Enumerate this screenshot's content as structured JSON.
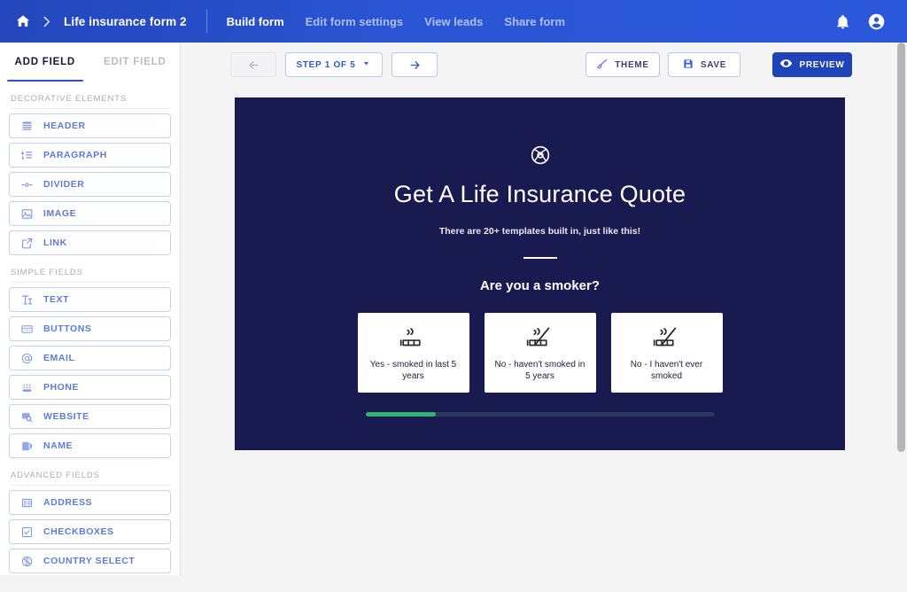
{
  "topbar": {
    "home_icon": "home-icon",
    "chevron_icon": "chevron-right-icon",
    "form_title": "Life insurance form 2",
    "nav": [
      {
        "label": "Build form",
        "active": true
      },
      {
        "label": "Edit form settings",
        "active": false
      },
      {
        "label": "View leads",
        "active": false
      },
      {
        "label": "Share form",
        "active": false
      }
    ],
    "notifications_icon": "bell-icon",
    "account_icon": "account-circle-icon",
    "accent_color": "#2a55d4"
  },
  "sidebar": {
    "tabs": [
      {
        "label": "ADD FIELD",
        "active": true
      },
      {
        "label": "EDIT FIELD",
        "active": false
      }
    ],
    "sections": [
      {
        "label": "DECORATIVE ELEMENTS",
        "items": [
          {
            "label": "HEADER",
            "icon": "header-lines-icon"
          },
          {
            "label": "PARAGRAPH",
            "icon": "paragraph-icon"
          },
          {
            "label": "DIVIDER",
            "icon": "divider-icon"
          },
          {
            "label": "IMAGE",
            "icon": "image-icon"
          },
          {
            "label": "LINK",
            "icon": "external-link-icon"
          }
        ]
      },
      {
        "label": "SIMPLE FIELDS",
        "items": [
          {
            "label": "TEXT",
            "icon": "text-cursor-icon"
          },
          {
            "label": "BUTTONS",
            "icon": "buttons-icon"
          },
          {
            "label": "EMAIL",
            "icon": "at-sign-icon"
          },
          {
            "label": "PHONE",
            "icon": "phone-keypad-icon"
          },
          {
            "label": "WEBSITE",
            "icon": "website-search-icon"
          },
          {
            "label": "NAME",
            "icon": "name-badge-icon"
          }
        ]
      },
      {
        "label": "ADVANCED FIELDS",
        "items": [
          {
            "label": "ADDRESS",
            "icon": "address-columns-icon"
          },
          {
            "label": "CHECKBOXES",
            "icon": "checkbox-icon"
          },
          {
            "label": "COUNTRY SELECT",
            "icon": "globe-icon"
          }
        ]
      }
    ]
  },
  "toolbar": {
    "back_icon": "arrow-left-icon",
    "forward_icon": "arrow-right-icon",
    "step_label": "STEP 1 OF 5",
    "step_caret_icon": "caret-down-icon",
    "theme_label": "THEME",
    "theme_icon": "paint-brush-icon",
    "save_label": "SAVE",
    "save_icon": "floppy-disk-icon",
    "preview_label": "PREVIEW",
    "preview_icon": "eye-icon"
  },
  "preview": {
    "logo_icon": "circular-emblem-logo",
    "title": "Get A Life Insurance Quote",
    "subtitle": "There are 20+ templates built in, just like this!",
    "question": "Are you a smoker?",
    "options": [
      {
        "label": "Yes - smoked in last 5 years",
        "icon": "cigarette-icon"
      },
      {
        "label": "No - haven't smoked in 5 years",
        "icon": "no-smoking-icon"
      },
      {
        "label": "No - I haven't ever smoked",
        "icon": "no-smoking-icon"
      }
    ],
    "progress_percent": 20,
    "progress_color": "#2fb573",
    "background_color": "#191a4f"
  },
  "fab": {
    "icon": "lifebuoy-help-icon"
  },
  "scrollbar": {
    "name": "page-scrollbar"
  }
}
